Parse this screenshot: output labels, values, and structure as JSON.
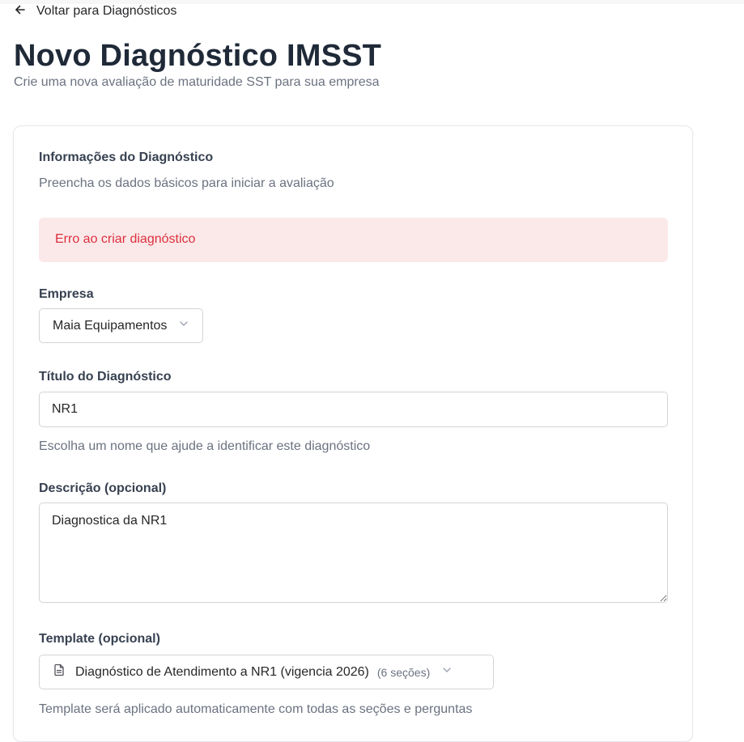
{
  "nav": {
    "back_label": "Voltar para Diagnósticos"
  },
  "header": {
    "title": "Novo Diagnóstico IMSST",
    "subtitle": "Crie uma nova avaliação de maturidade SST para sua empresa"
  },
  "form": {
    "title": "Informações do Diagnóstico",
    "description": "Preencha os dados básicos para iniciar a avaliação",
    "error_message": "Erro ao criar diagnóstico",
    "company": {
      "label": "Empresa",
      "value": "Maia Equipamentos"
    },
    "diag_title": {
      "label": "Título do Diagnóstico",
      "value": "NR1",
      "helper": "Escolha um nome que ajude a identificar este diagnóstico"
    },
    "description_field": {
      "label": "Descrição (opcional)",
      "value": "Diagnostica da NR1"
    },
    "template": {
      "label": "Template (opcional)",
      "value": "Diagnóstico de Atendimento a NR1 (vigencia 2026)",
      "sections": "(6 seções)",
      "helper": "Template será aplicado automaticamente com todas as seções e perguntas"
    }
  },
  "colors": {
    "error_bg": "#fbe9ea",
    "error_text": "#dc2f3c",
    "border": "#d4d4d8"
  },
  "icons": {
    "back": "arrow-left-icon",
    "chevron": "chevron-down-icon",
    "template": "file-text-icon"
  }
}
